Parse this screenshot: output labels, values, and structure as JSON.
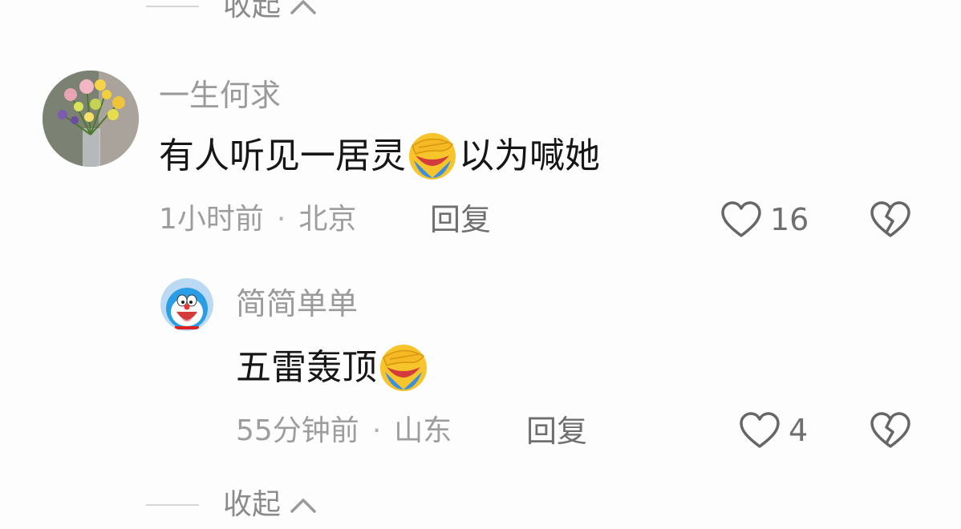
{
  "collapse": {
    "label": "收起"
  },
  "comment": {
    "username": "一生何求",
    "text_before": "有人听见一居灵",
    "text_after": "以为喊她",
    "time": "1小时前",
    "separator": "·",
    "location": "北京",
    "reply_label": "回复",
    "like_count": "16"
  },
  "reply": {
    "username": "简简单单",
    "text_before": "五雷轰顶",
    "time": "55分钟前",
    "separator": "·",
    "location": "山东",
    "reply_label": "回复",
    "like_count": "4"
  },
  "icons": {
    "emoji": "face-palm-laughing-emoji",
    "like": "heart-icon",
    "dislike": "broken-heart-icon",
    "collapse": "chevron-up-icon"
  },
  "colors": {
    "emoji_yellow": "#f7c52b",
    "emoji_blue": "#3a8fe0"
  }
}
